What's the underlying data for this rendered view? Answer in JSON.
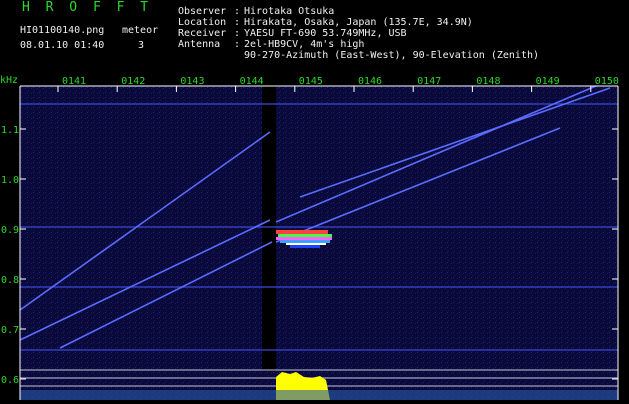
{
  "header": {
    "app_title": "H R O F F T",
    "filename": "HI01100140.png",
    "mode": "meteor",
    "datetime": "08.01.10 01:40",
    "count": "3",
    "info": [
      {
        "key": "Observer",
        "value": "Hirotaka Otsuka"
      },
      {
        "key": "Location",
        "value": "Hirakata, Osaka, Japan (135.7E, 34.9N)"
      },
      {
        "key": "Receiver",
        "value": "YAESU FT-690 53.749MHz, USB"
      },
      {
        "key": "Antenna",
        "value": "2el-HB9CV, 4m's high"
      }
    ],
    "antenna_line2": "90-270-Azimuth (East-West), 90-Elevation (Zenith)"
  },
  "spectrogram": {
    "y_unit": "kHz",
    "y_ticks": [
      "1.1",
      "1.0",
      "0.9",
      "0.8",
      "0.7",
      "0.6"
    ],
    "y_values": [
      1.1,
      1.0,
      0.9,
      0.8,
      0.7,
      0.6
    ],
    "x_ticks": [
      "0141",
      "0142",
      "0143",
      "0144",
      "0145",
      "0146",
      "0147",
      "0148",
      "0149",
      "0150"
    ],
    "colors": {
      "background": "#0a0a3a",
      "trace": "#5a6cff",
      "signal": "#ffff00",
      "axis": "#ffffff",
      "label": "#2bd92b"
    }
  }
}
